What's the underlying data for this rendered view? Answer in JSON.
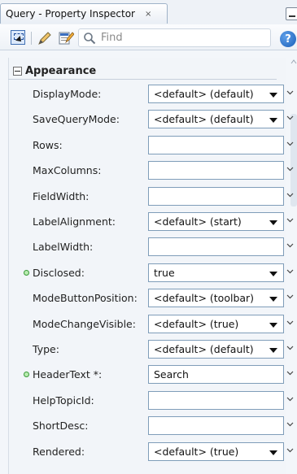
{
  "tab": {
    "title": "Query - Property Inspector",
    "close": "×"
  },
  "toolbar": {
    "find_placeholder": "Find",
    "help_label": "?"
  },
  "section": {
    "title": "Appearance"
  },
  "properties": [
    {
      "label": "DisplayMode:",
      "value": "<default> (default)",
      "kind": "select",
      "modified": false
    },
    {
      "label": "SaveQueryMode:",
      "value": "<default> (default)",
      "kind": "select",
      "modified": false
    },
    {
      "label": "Rows:",
      "value": "",
      "kind": "text",
      "modified": false
    },
    {
      "label": "MaxColumns:",
      "value": "",
      "kind": "text",
      "modified": false
    },
    {
      "label": "FieldWidth:",
      "value": "",
      "kind": "text",
      "modified": false
    },
    {
      "label": "LabelAlignment:",
      "value": "<default> (start)",
      "kind": "select",
      "modified": false
    },
    {
      "label": "LabelWidth:",
      "value": "",
      "kind": "text",
      "modified": false
    },
    {
      "label": "Disclosed:",
      "value": "true",
      "kind": "select",
      "modified": true
    },
    {
      "label": "ModeButtonPosition:",
      "value": "<default> (toolbar)",
      "kind": "select",
      "modified": false
    },
    {
      "label": "ModeChangeVisible:",
      "value": "<default> (true)",
      "kind": "select",
      "modified": false
    },
    {
      "label": "Type:",
      "value": "<default> (default)",
      "kind": "select",
      "modified": false
    },
    {
      "label": "HeaderText *:",
      "value": "Search",
      "kind": "text",
      "modified": true
    },
    {
      "label": "HelpTopicId:",
      "value": "",
      "kind": "text",
      "modified": false
    },
    {
      "label": "ShortDesc:",
      "value": "",
      "kind": "text",
      "modified": false
    },
    {
      "label": "Rendered:",
      "value": "<default> (true)",
      "kind": "select",
      "modified": false
    }
  ],
  "colors": {
    "accent": "#1b5fb8",
    "modified_dot": "#3a9a3a",
    "field_border": "#7f9db9"
  }
}
